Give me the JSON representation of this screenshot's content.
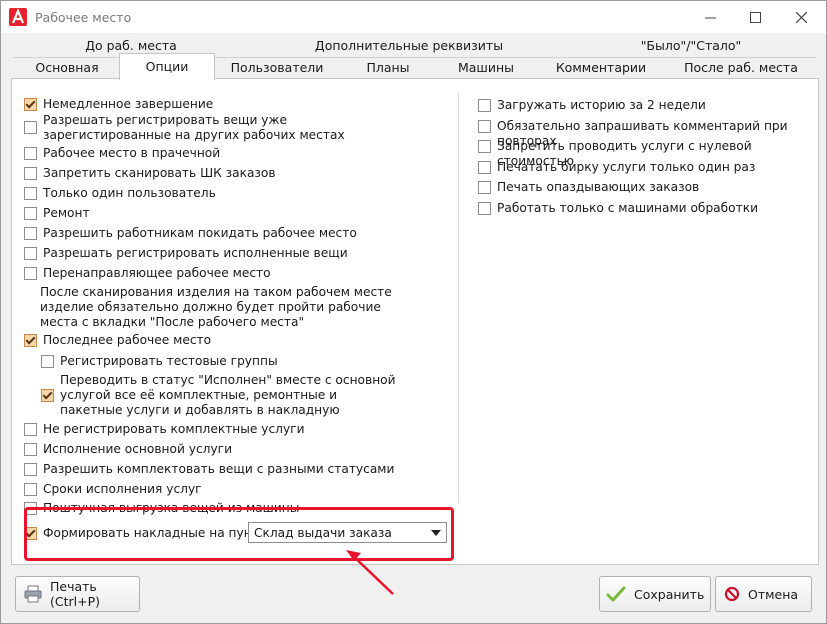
{
  "window": {
    "title": "Рабочее место",
    "controls": {
      "minimize": "—",
      "maximize": "☐",
      "close": "✕"
    }
  },
  "tabs": {
    "row1": [
      "До раб. места",
      "Дополнительные реквизиты",
      "\"Было\"/\"Стало\""
    ],
    "row2": [
      "Основная",
      "Опции",
      "Пользователи",
      "Планы",
      "Машины",
      "Комментарии",
      "После раб. места"
    ],
    "active": "Опции"
  },
  "left_options": [
    {
      "label": "Немедленное завершение",
      "checked": true
    },
    {
      "label": "Разрешать регистрировать вещи уже зарегистированные на других рабочих местах",
      "checked": false
    },
    {
      "label": "Рабочее место в прачечной",
      "checked": false
    },
    {
      "label": "Запретить сканировать ШК заказов",
      "checked": false
    },
    {
      "label": "Только один пользователь",
      "checked": false
    },
    {
      "label": "Ремонт",
      "checked": false
    },
    {
      "label": "Разрешить работникам покидать рабочее место",
      "checked": false
    },
    {
      "label": "Разрешать регистрировать исполненные вещи",
      "checked": false
    },
    {
      "label": "Перенаправляющее рабочее место",
      "checked": false
    },
    {
      "label": "Последнее рабочее место",
      "checked": true
    },
    {
      "label": "Регистрировать тестовые группы",
      "checked": false
    },
    {
      "label": "Переводить в статус \"Исполнен\" вместе с основной услугой все её комплектные, ремонтные и пакетные услуги и добавлять в накладную",
      "checked": true
    },
    {
      "label": "Не регистрировать комплектные услуги",
      "checked": false
    },
    {
      "label": "Исполнение основной услуги",
      "checked": false
    },
    {
      "label": "Разрешить комплектовать вещи с разными статусами",
      "checked": false
    },
    {
      "label": "Сроки исполнения услуг",
      "checked": false
    },
    {
      "label": "Поштучная выгрузка вещей из машины",
      "checked": false
    },
    {
      "label": "Формировать накладные на пункт",
      "checked": true
    }
  ],
  "redirect_note": "После сканирования изделия на таком рабочем месте изделие обязательно должно будет пройти рабочие места с вкладки \"После рабочего места\"",
  "waybill_select": {
    "value": "Склад выдачи заказа"
  },
  "right_options": [
    {
      "label": "Загружать историю за 2 недели",
      "checked": false
    },
    {
      "label": "Обязательно запрашивать комментарий при повторах",
      "checked": false
    },
    {
      "label": "Запретить проводить услуги с нулевой стоимостью",
      "checked": false
    },
    {
      "label": "Печатать бирку услуги только один раз",
      "checked": false
    },
    {
      "label": "Печать опаздывающих заказов",
      "checked": false
    },
    {
      "label": "Работать только с машинами обработки",
      "checked": false
    }
  ],
  "buttons": {
    "print": "Печать (Ctrl+P)",
    "save": "Сохранить",
    "cancel": "Отмена"
  },
  "colors": {
    "highlight": "#e8142c",
    "check_fill": "#f5d6a6",
    "save_icon": "#7ab83a",
    "cancel_icon": "#c8102e"
  }
}
